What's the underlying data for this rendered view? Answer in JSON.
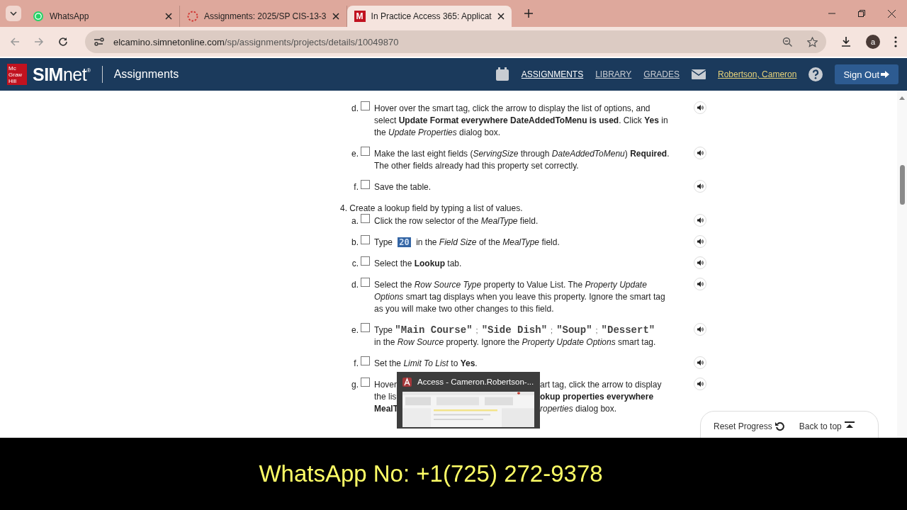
{
  "browser": {
    "tabs": [
      {
        "title": "WhatsApp",
        "kind": "whatsapp",
        "selected": false
      },
      {
        "title": "Assignments: 2025/SP CIS-13-3",
        "kind": "loading",
        "selected": false
      },
      {
        "title": "In Practice Access 365: Applicat",
        "kind": "m",
        "selected": true
      }
    ],
    "tab_icon_letter": "M",
    "url_domain": "elcamino.simnetonline.com",
    "url_path": "/sp/assignments/projects/details/10049870",
    "profile": "a"
  },
  "header": {
    "logo_lines": [
      "Mc",
      "Graw",
      "Hill"
    ],
    "brand_bold": "SIM",
    "brand_light": "net",
    "brand_mark": "®",
    "section": "Assignments",
    "nav": [
      {
        "label": "ASSIGNMENTS",
        "selected": true
      },
      {
        "label": "LIBRARY",
        "selected": false
      },
      {
        "label": "GRADES",
        "selected": false
      }
    ],
    "user": "Robertson, Cameron",
    "sign_out": "Sign Out"
  },
  "steps": [
    {
      "items": [
        {
          "letter": "d.",
          "checked": false,
          "kind": "text",
          "text": "Hover over the smart tag, click the arrow to display the list of options, and select **Update Format everywhere DateAddedToMenu is used**. Click **Yes** in the *Update Properties* dialog box."
        },
        {
          "letter": "e.",
          "checked": false,
          "kind": "text",
          "text": "Make the last eight fields (*ServingSize* through *DateAddedToMenu*) **Required**. The other fields already had this property set correctly."
        },
        {
          "letter": "f.",
          "checked": false,
          "kind": "text",
          "text": "Save the table."
        }
      ]
    },
    {
      "number": "4.",
      "title": "Create a lookup field by typing a list of values.",
      "items": [
        {
          "letter": "a.",
          "checked": false,
          "kind": "text",
          "text": "Click the row selector of the *MealType* field."
        },
        {
          "letter": "b.",
          "checked": false,
          "kind": "type_value",
          "prefix": "Type",
          "value": "20",
          "value_selected": true,
          "suffix": "in the *Field Size* of the *MealType* field."
        },
        {
          "letter": "c.",
          "checked": false,
          "kind": "text",
          "text": "Select the **Lookup** tab."
        },
        {
          "letter": "d.",
          "checked": false,
          "kind": "text",
          "text": "Select the *Row Source Type* property to Value List. The *Property Update Options* smart tag displays when you leave this property. Ignore the smart tag as you will make two other changes to this field."
        },
        {
          "letter": "e.",
          "checked": false,
          "kind": "type_list",
          "prefix": "Type",
          "values": [
            "\"Main Course\"",
            "\"Side Dish\"",
            "\"Soup\"",
            "\"Dessert\""
          ],
          "separators": [
            ";",
            ";",
            ";"
          ],
          "suffix": "in the *Row Source* property. Ignore the *Property Update Options* smart tag."
        },
        {
          "letter": "f.",
          "checked": false,
          "kind": "text",
          "text": "Set the *Limit To List* to **Yes**."
        },
        {
          "letter": "g.",
          "checked": false,
          "kind": "covered",
          "lines": [
            {
              "left": "Hover",
              "right": "art tag, click the arrow to display"
            },
            {
              "left": "the lis",
              "right": "**okup properties everywhere**"
            },
            {
              "left": "**MealT**",
              "right": "*roperties* dialog box."
            }
          ]
        }
      ]
    }
  ],
  "floating": {
    "reset": "Reset Progress",
    "back": "Back to top"
  },
  "taskbar_preview": {
    "title": "Access - Cameron.Robertson-..."
  },
  "caption": "WhatsApp No: +1(725) 272-9378"
}
